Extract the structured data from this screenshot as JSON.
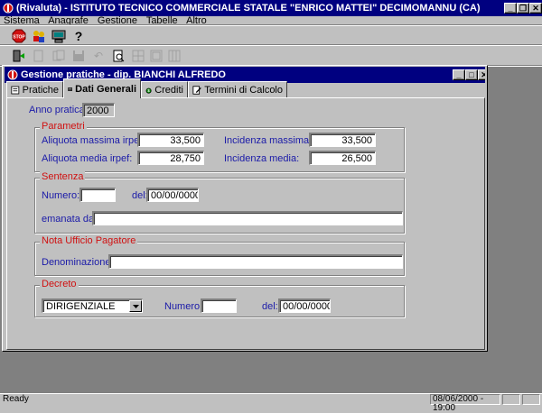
{
  "app": {
    "title": "(Rivaluta) - ISTITUTO TECNICO COMMERCIALE STATALE \"ENRICO MATTEI\" DECIMOMANNU (CA)",
    "menu": [
      "Sistema",
      "Anagrafe",
      "Gestione",
      "Tabelle",
      "Altro"
    ]
  },
  "child": {
    "title": "Gestione pratiche - dip. BIANCHI ALFREDO",
    "tabs": [
      "Pratiche",
      "Dati Generali",
      "Crediti",
      "Termini di Calcolo"
    ]
  },
  "form": {
    "anno_label": "Anno pratica:",
    "anno_value": "2000",
    "parametri": {
      "title": "Parametri",
      "aliquota_max_label": "Aliquota massima irpef:",
      "aliquota_max_value": "33,500",
      "aliquota_media_label": "Aliquota media irpef:",
      "aliquota_media_value": "28,750",
      "incidenza_max_label": "Incidenza massima:",
      "incidenza_max_value": "33,500",
      "incidenza_media_label": "Incidenza media:",
      "incidenza_media_value": "26,500"
    },
    "sentenza": {
      "title": "Sentenza",
      "numero_label": "Numero:",
      "numero_value": "",
      "del_label": "del:",
      "del_value": "00/00/0000",
      "emanata_label": "emanata da:",
      "emanata_value": ""
    },
    "nota": {
      "title": "Nota Ufficio Pagatore",
      "denominazione_label": "Denominazione:",
      "denominazione_value": ""
    },
    "decreto": {
      "title": "Decreto",
      "tipo_value": "DIRIGENZIALE",
      "numero_label": "Numero:",
      "numero_value": "",
      "del_label": "del:",
      "del_value": "00/00/0000"
    }
  },
  "status": {
    "text": "Ready",
    "datetime": "08/06/2000 - 19:00"
  },
  "colors": {
    "titlebar": "#000080",
    "label": "#1a1aa8",
    "group_title": "#d01010"
  }
}
